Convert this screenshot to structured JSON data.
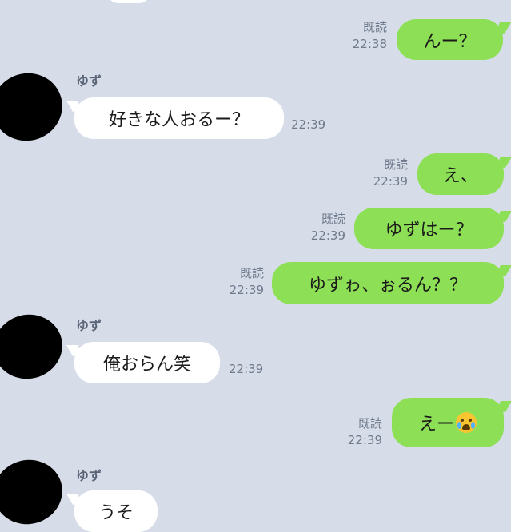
{
  "contact_name": "ゆず",
  "read_label": "既読",
  "messages": [
    {
      "side": "out",
      "text": "んー？",
      "time": "22:38",
      "read": true
    },
    {
      "side": "in",
      "sender": "ゆず",
      "text": "好きな人おるー？",
      "time": "22:39"
    },
    {
      "side": "out",
      "text": "え、",
      "time": "22:39",
      "read": true
    },
    {
      "side": "out",
      "text": "ゆずはー？",
      "time": "22:39",
      "read": true
    },
    {
      "side": "out",
      "text": "ゆずゎ、ぉるん？？",
      "time": "22:39",
      "read": true
    },
    {
      "side": "in",
      "sender": "ゆず",
      "text": "俺おらん笑",
      "time": "22:39"
    },
    {
      "side": "out",
      "text": "えー",
      "emoji": "loudly-crying-face-icon",
      "time": "22:39",
      "read": true
    },
    {
      "side": "in",
      "sender": "ゆず",
      "text": "うそ",
      "time": ""
    }
  ],
  "colors": {
    "background": "#d7dde8",
    "outgoing_bubble": "#8de055",
    "incoming_bubble": "#ffffff"
  }
}
